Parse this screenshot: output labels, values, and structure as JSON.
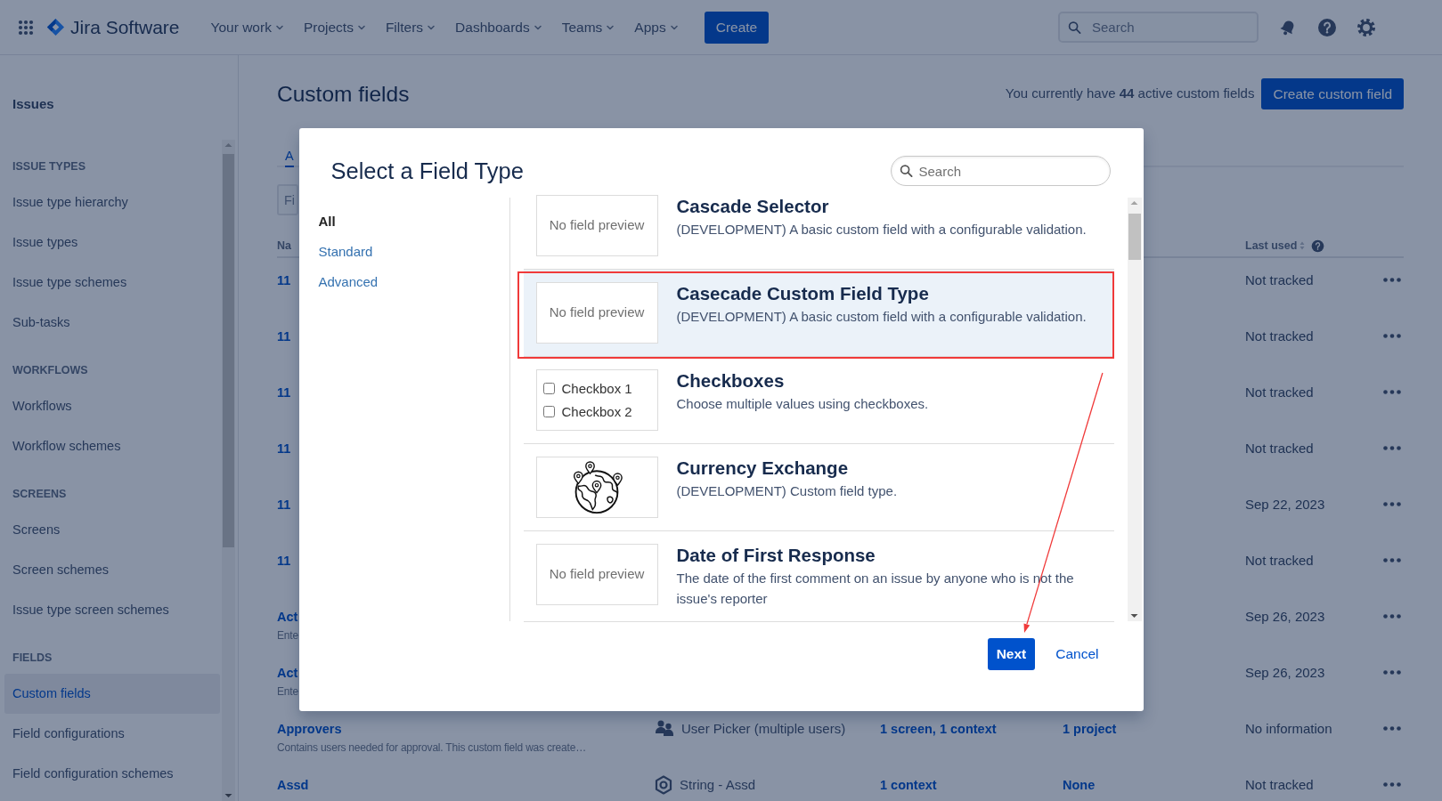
{
  "top_nav": {
    "product": "Jira Software",
    "menus": [
      {
        "label": "Your work"
      },
      {
        "label": "Projects"
      },
      {
        "label": "Filters"
      },
      {
        "label": "Dashboards"
      },
      {
        "label": "Teams"
      },
      {
        "label": "Apps"
      }
    ],
    "create": "Create",
    "search": {
      "placeholder": "Search"
    }
  },
  "sidebar": {
    "title": "Issues",
    "sections": [
      {
        "heading": "ISSUE TYPES",
        "items": [
          {
            "label": "Issue type hierarchy",
            "selected": false
          },
          {
            "label": "Issue types",
            "selected": false
          },
          {
            "label": "Issue type schemes",
            "selected": false
          },
          {
            "label": "Sub-tasks",
            "selected": false
          }
        ]
      },
      {
        "heading": "WORKFLOWS",
        "items": [
          {
            "label": "Workflows",
            "selected": false
          },
          {
            "label": "Workflow schemes",
            "selected": false
          }
        ]
      },
      {
        "heading": "SCREENS",
        "items": [
          {
            "label": "Screens",
            "selected": false
          },
          {
            "label": "Screen schemes",
            "selected": false
          },
          {
            "label": "Issue type screen schemes",
            "selected": false
          }
        ]
      },
      {
        "heading": "FIELDS",
        "items": [
          {
            "label": "Custom fields",
            "selected": true
          },
          {
            "label": "Field configurations",
            "selected": false
          },
          {
            "label": "Field configuration schemes",
            "selected": false
          }
        ]
      }
    ]
  },
  "page": {
    "title": "Custom fields",
    "summary": "You currently have **44** active custom fields",
    "create_button": "Create custom field",
    "tabs": [
      {
        "label": "A",
        "selected": true
      }
    ],
    "filter": {
      "placeholder": "Fi"
    },
    "table": {
      "columns": [
        {
          "label": "Na",
          "sortable": false,
          "help": false
        },
        {
          "label": "Last used",
          "sortable": true,
          "help": true
        }
      ],
      "rows": [
        {
          "name": "11",
          "last_used": "Not tracked"
        },
        {
          "name": "11",
          "last_used": "Not tracked"
        },
        {
          "name": "11",
          "last_used": "Not tracked"
        },
        {
          "name": "11",
          "last_used": "Not tracked"
        },
        {
          "name": "11",
          "last_used": "Sep 22, 2023"
        },
        {
          "name": "11",
          "last_used": "Not tracked"
        },
        {
          "name": "Act",
          "description": "Ente",
          "last_used": "Sep 26, 2023"
        },
        {
          "name": "Act",
          "description": "Ente",
          "last_used": "Sep 26, 2023"
        },
        {
          "name": "Approvers",
          "description": "Contains users needed for approval. This custom field was create…",
          "type": {
            "kind": "user-picker",
            "label": "User Picker (multiple users)"
          },
          "screens": "1 screen, 1 context",
          "projects": "1 project",
          "last_used": "No information"
        },
        {
          "name": "Assd",
          "type": {
            "kind": "string",
            "label": "String - Assd"
          },
          "screens": "1 context",
          "projects": "None",
          "last_used": "Not tracked"
        }
      ]
    }
  },
  "modal": {
    "title": "Select a Field Type",
    "search": {
      "placeholder": "Search"
    },
    "categories": [
      {
        "label": "All",
        "selected": true
      },
      {
        "label": "Standard",
        "selected": false
      },
      {
        "label": "Advanced",
        "selected": false
      }
    ],
    "field_types": [
      {
        "name": "Cascade Selector",
        "description": "(DEVELOPMENT) A basic custom field with a configurable validation.",
        "selected": false,
        "annotated": false,
        "preview": {
          "kind": "none",
          "text": "No field preview"
        }
      },
      {
        "name": "Casecade Custom Field Type",
        "description": "(DEVELOPMENT) A basic custom field with a configurable validation.",
        "selected": true,
        "annotated": true,
        "preview": {
          "kind": "none",
          "text": "No field preview"
        }
      },
      {
        "name": "Checkboxes",
        "description": "Choose multiple values using checkboxes.",
        "selected": false,
        "annotated": false,
        "preview": {
          "kind": "checkboxes",
          "options": [
            {
              "label": "Checkbox 1",
              "checked": false
            },
            {
              "label": "Checkbox 2",
              "checked": false
            }
          ]
        }
      },
      {
        "name": "Currency Exchange",
        "description": "(DEVELOPMENT) Custom field type.",
        "selected": false,
        "annotated": false,
        "preview": {
          "kind": "globe"
        }
      },
      {
        "name": "Date of First Response",
        "description": "The date of the first comment on an issue by anyone who is not the issue's reporter",
        "selected": false,
        "annotated": false,
        "preview": {
          "kind": "none",
          "text": "No field preview"
        }
      }
    ],
    "annotation_arrow": true,
    "next": "Next",
    "cancel": "Cancel"
  }
}
